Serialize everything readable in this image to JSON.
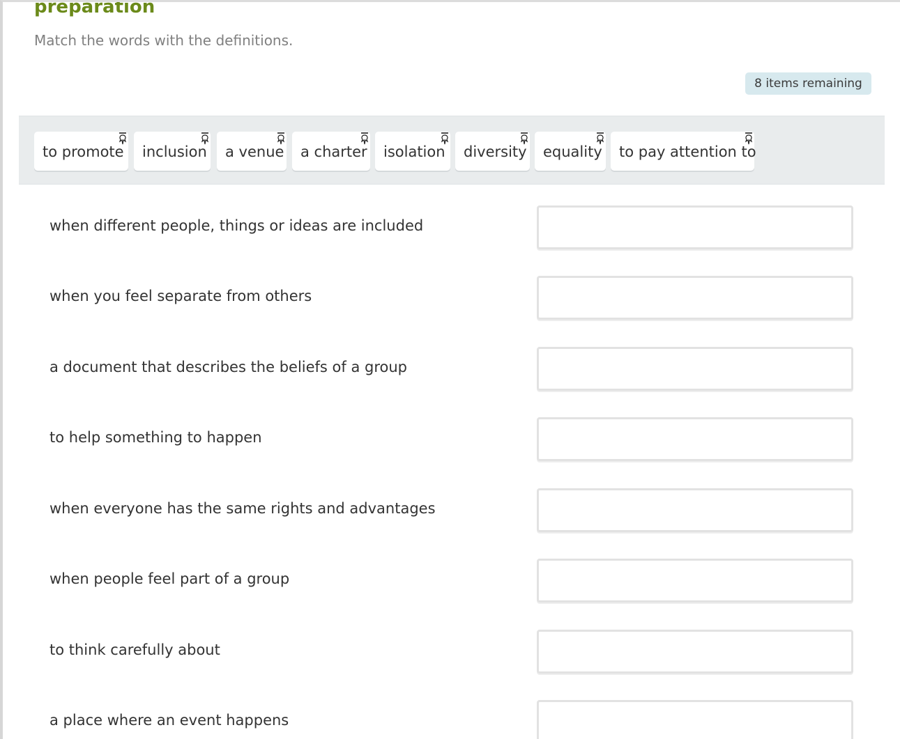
{
  "header": {
    "title": "preparation",
    "instruction": "Match the words with the definitions."
  },
  "status": {
    "remaining_text": "8 items remaining"
  },
  "word_bank": {
    "icon": "drag-handle-icon",
    "words": [
      "to promote",
      "inclusion",
      "a venue",
      "a charter",
      "isolation",
      "diversity",
      "equality",
      "to pay attention to"
    ]
  },
  "definitions": [
    "when different people, things or ideas are included",
    "when you feel separate from others",
    "a document that describes the beliefs of a group",
    "to help something to happen",
    "when everyone has the same rights and advantages",
    "when people feel part of a group",
    "to think carefully about",
    "a place where an event happens"
  ],
  "colors": {
    "title": "#6b8a1a",
    "badge_bg": "#d7e9ee",
    "word_bank_bg": "#e9eced"
  }
}
